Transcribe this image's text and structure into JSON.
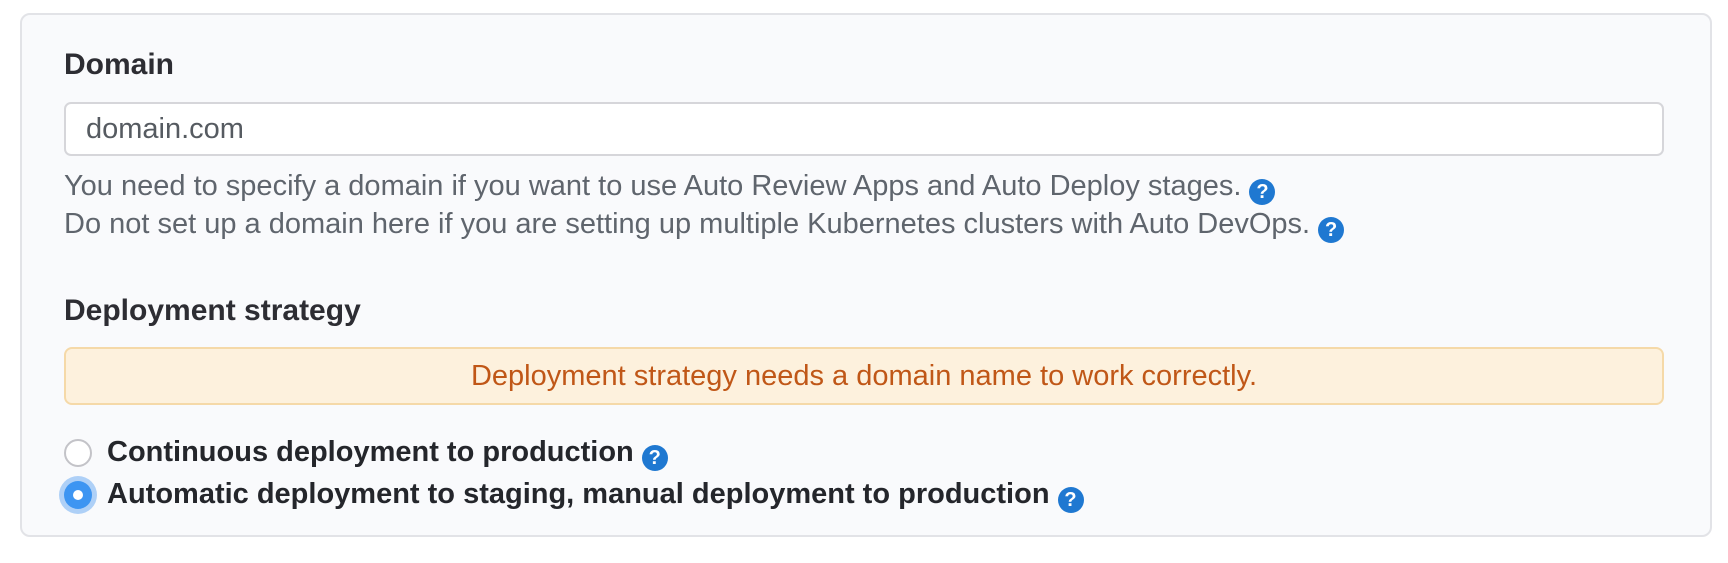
{
  "domain_section": {
    "label": "Domain",
    "input_value": "domain.com",
    "help": [
      {
        "text": "You need to specify a domain if you want to use Auto Review Apps and Auto Deploy stages."
      },
      {
        "text": "Do not set up a domain here if you are setting up multiple Kubernetes clusters with Auto DevOps."
      }
    ]
  },
  "deployment_section": {
    "label": "Deployment strategy",
    "warning_message": "Deployment strategy needs a domain name to work correctly.",
    "options": [
      {
        "label": "Continuous deployment to production",
        "selected": false
      },
      {
        "label": "Automatic deployment to staging, manual deployment to production",
        "selected": true
      }
    ]
  },
  "icons": {
    "help_glyph": "?"
  },
  "colors": {
    "help_icon_blue": "#1f78d1",
    "warning_background": "#fdf1dd",
    "warning_border": "#f5d9a8",
    "warning_text": "#c05717",
    "radio_checked_blue": "#3d95f2",
    "radio_halo_blue": "#aed0f7"
  }
}
